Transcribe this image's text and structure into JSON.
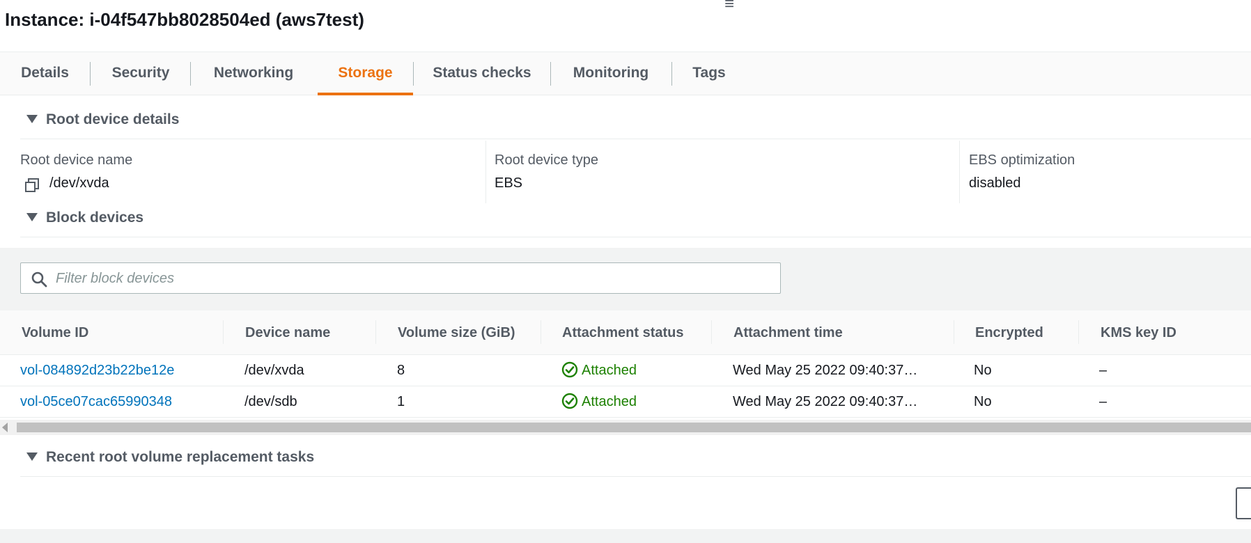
{
  "header": {
    "title": "Instance: i-04f547bb8028504ed (aws7test)",
    "drag_handle_icon": "hamburger-icon"
  },
  "tabs": [
    {
      "label": "Details",
      "active": false
    },
    {
      "label": "Security",
      "active": false
    },
    {
      "label": "Networking",
      "active": false
    },
    {
      "label": "Storage",
      "active": true
    },
    {
      "label": "Status checks",
      "active": false
    },
    {
      "label": "Monitoring",
      "active": false
    },
    {
      "label": "Tags",
      "active": false
    }
  ],
  "root_device": {
    "heading": "Root device details",
    "name_label": "Root device name",
    "name_value": "/dev/xvda",
    "type_label": "Root device type",
    "type_value": "EBS",
    "ebs_label": "EBS optimization",
    "ebs_value": "disabled"
  },
  "block_devices": {
    "heading": "Block devices",
    "filter_placeholder": "Filter block devices",
    "columns": [
      "Volume ID",
      "Device name",
      "Volume size (GiB)",
      "Attachment status",
      "Attachment time",
      "Encrypted",
      "KMS key ID"
    ],
    "rows": [
      {
        "volume_id": "vol-084892d23b22be12e",
        "device": "/dev/xvda",
        "size": "8",
        "status": "Attached",
        "time": "Wed May 25 2022 09:40:37…",
        "encrypted": "No",
        "kms": "–"
      },
      {
        "volume_id": "vol-05ce07cac65990348",
        "device": "/dev/sdb",
        "size": "1",
        "status": "Attached",
        "time": "Wed May 25 2022 09:40:37…",
        "encrypted": "No",
        "kms": "–"
      }
    ]
  },
  "replacement": {
    "heading": "Recent root volume replacement tasks"
  },
  "colors": {
    "accent_tab": "#ec7211",
    "link": "#0073bb",
    "success": "#1d8102"
  }
}
